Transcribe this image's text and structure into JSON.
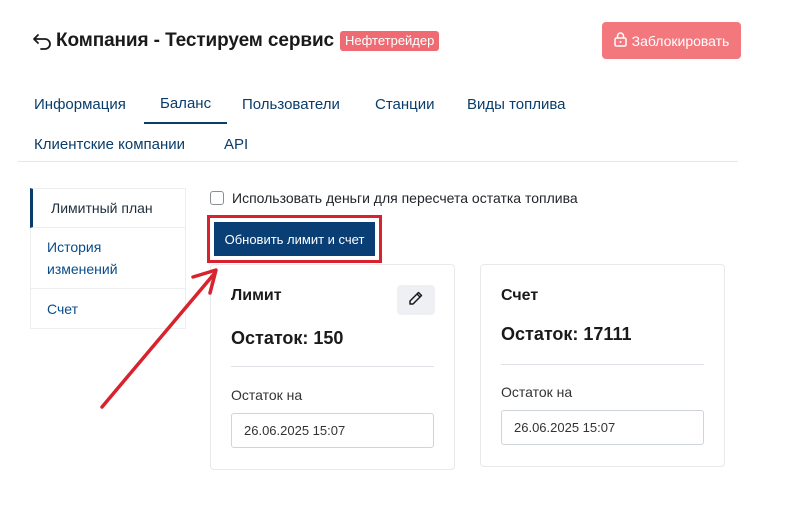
{
  "header": {
    "title": "Компания - Тестируем сервис",
    "badge": "Нефтетрейдер",
    "lock_label": "Заблокировать"
  },
  "tabs": [
    {
      "label": "Информация"
    },
    {
      "label": "Баланс",
      "active": true
    },
    {
      "label": "Пользователи"
    },
    {
      "label": "Станции"
    },
    {
      "label": "Виды топлива"
    },
    {
      "label": "Клиентские компании"
    },
    {
      "label": "API"
    }
  ],
  "sidebar": {
    "items": [
      {
        "label": "Лимитный план",
        "active": true
      },
      {
        "label": "История изменений"
      },
      {
        "label": "Счет"
      }
    ]
  },
  "checkbox": {
    "label": "Использовать деньги для пересчета остатка топлива",
    "checked": false
  },
  "update_button": {
    "label": "Обновить лимит и счет"
  },
  "cards": {
    "limit": {
      "title": "Лимит",
      "balance": "Остаток: 150",
      "date_label": "Остаток на",
      "date_value": "26.06.2025 15:07"
    },
    "account": {
      "title": "Счет",
      "balance": "Остаток: 17111",
      "date_label": "Остаток на",
      "date_value": "26.06.2025 15:07"
    }
  },
  "colors": {
    "primary": "#0a3f75",
    "danger": "#f3787e",
    "badge": "#ef6b73",
    "highlight": "#d8232f"
  },
  "icons": {
    "back": "back-arrow-icon",
    "lock": "lock-icon",
    "edit": "pencil-icon"
  }
}
